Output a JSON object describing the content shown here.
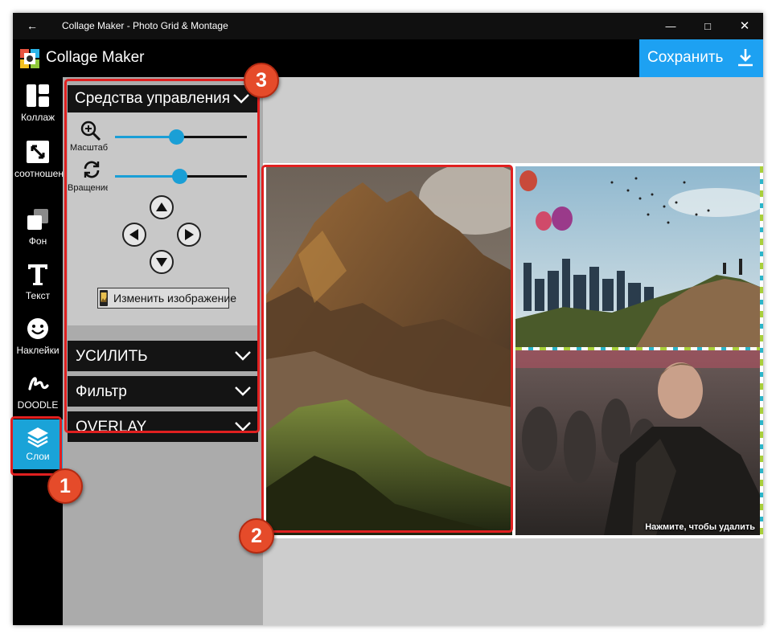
{
  "window": {
    "title": "Collage Maker - Photo Grid & Montage"
  },
  "header": {
    "app_name": "Collage Maker",
    "save_label": "Сохранить"
  },
  "sidebar": {
    "items": [
      {
        "label": "Коллаж",
        "icon": "grid-icon"
      },
      {
        "label": "соотношение",
        "icon": "resize-icon"
      },
      {
        "label": "Фон",
        "icon": "background-icon"
      },
      {
        "label": "Текст",
        "icon": "text-icon"
      },
      {
        "label": "Наклейки",
        "icon": "sticker-icon"
      },
      {
        "label": "DOODLE",
        "icon": "doodle-icon"
      },
      {
        "label": "Слои",
        "icon": "layers-icon",
        "active": true
      }
    ]
  },
  "controls": {
    "header": "Средства управления",
    "zoom_label": "Масштаб",
    "rotate_label": "Вращение",
    "zoom_value": 0.46,
    "rotate_value": 0.49,
    "change_image_label": "Изменить изображение"
  },
  "accordions": [
    {
      "label": "УСИЛИТЬ"
    },
    {
      "label": "Фильтр"
    },
    {
      "label": "OVERLAY"
    }
  ],
  "collage": {
    "delete_hint": "Нажмите, чтобы удалить"
  },
  "annotations": {
    "badge_1": "1",
    "badge_2": "2",
    "badge_3": "3"
  },
  "colors": {
    "accent": "#1da1f2",
    "active_tab": "#1aa3d8",
    "highlight": "#e02020",
    "badge": "#e54b2a"
  }
}
